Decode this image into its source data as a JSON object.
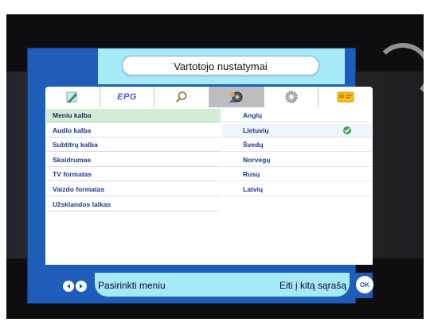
{
  "header": {
    "title": "Vartotojo nustatymai"
  },
  "tabs": [
    {
      "icon": "pencil-icon"
    },
    {
      "label": "EPG",
      "icon": "epg-icon"
    },
    {
      "icon": "magnifier-icon"
    },
    {
      "icon": "user-settings-icon",
      "active": true
    },
    {
      "icon": "gear-icon"
    },
    {
      "icon": "smartcard-icon"
    }
  ],
  "settings_list": [
    {
      "label": "Meniu kalba",
      "selected": true
    },
    {
      "label": "Audio kalba"
    },
    {
      "label": "Subtitrų kalba"
    },
    {
      "label": "Skaidrumas"
    },
    {
      "label": "TV formatas"
    },
    {
      "label": "Vaizdo formatas"
    },
    {
      "label": "Užsklandos laikas"
    }
  ],
  "language_options": [
    {
      "label": "Anglų"
    },
    {
      "label": "Lietuvių",
      "checked": true
    },
    {
      "label": "Švedų"
    },
    {
      "label": "Norvegų"
    },
    {
      "label": "Rusų"
    },
    {
      "label": "Latvių"
    }
  ],
  "footer": {
    "left_hint": "Pasirinkti meniu",
    "right_hint": "Eiti į kitą sąrašą",
    "ok_label": "OK"
  },
  "colors": {
    "panel_blue": "#1f5dbb",
    "header_cyan": "#a6eaf7",
    "selected_green": "#d2ecd6",
    "check_green": "#3fa34d"
  }
}
